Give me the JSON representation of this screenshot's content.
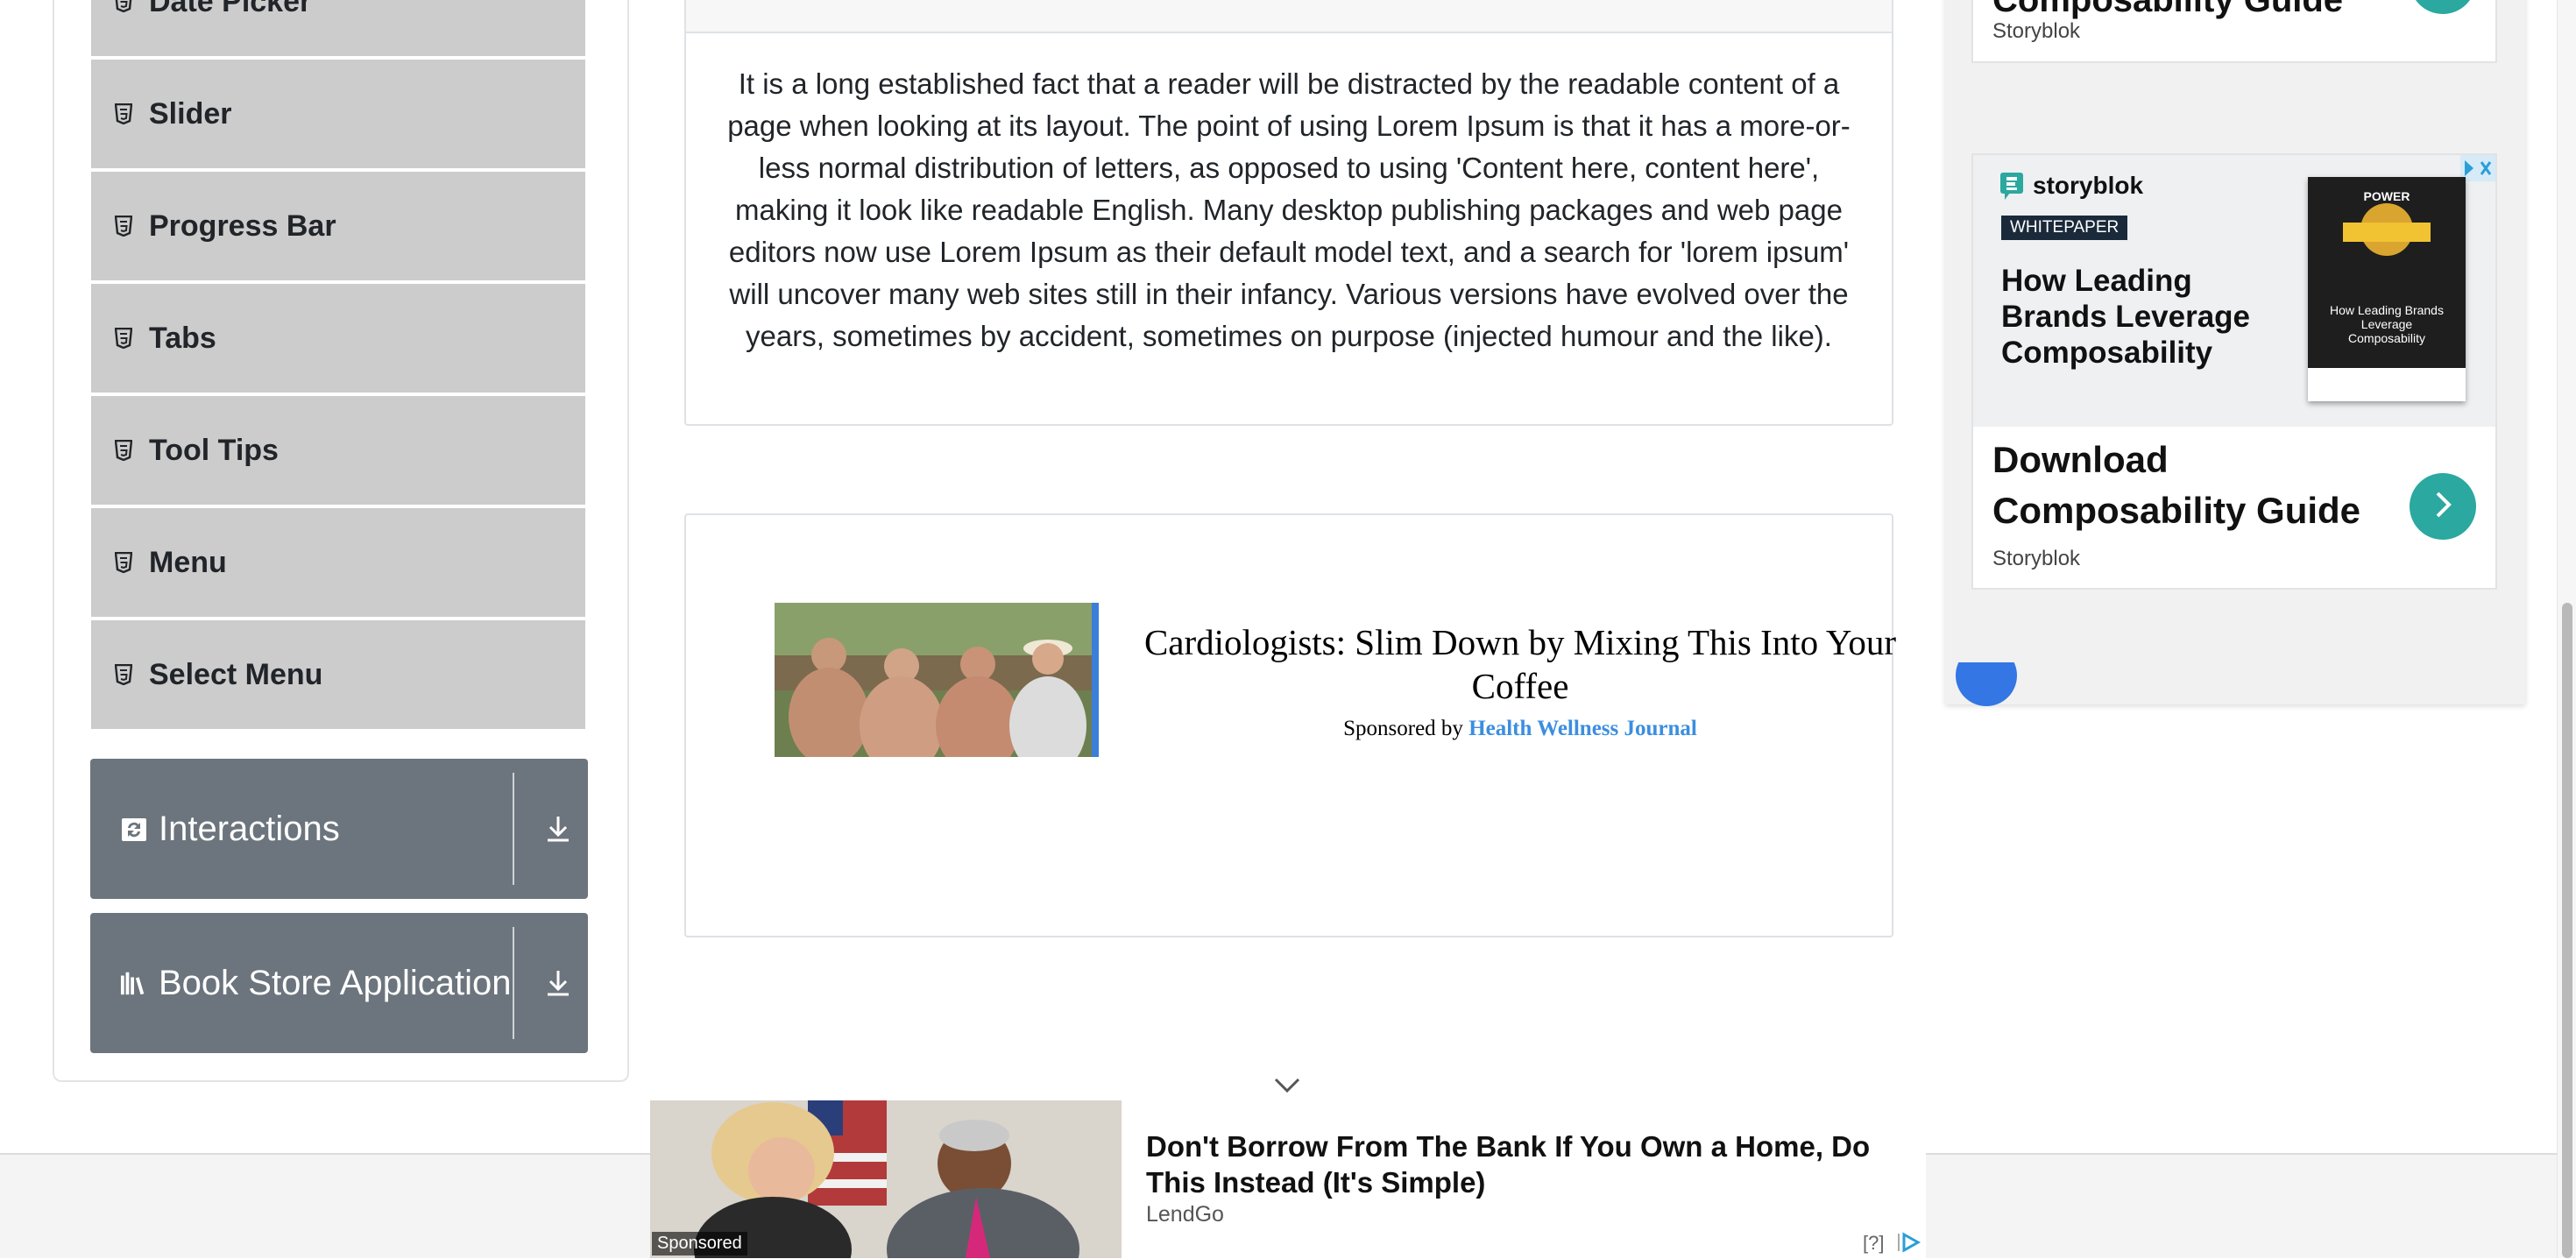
{
  "sidebar": {
    "elements_items": [
      {
        "label": "Date Picker"
      },
      {
        "label": "Slider"
      },
      {
        "label": "Progress Bar"
      },
      {
        "label": "Tabs"
      },
      {
        "label": "Tool Tips"
      },
      {
        "label": "Menu"
      },
      {
        "label": "Select Menu"
      }
    ],
    "groups": [
      {
        "label": "Interactions",
        "icon": "interactions-icon"
      },
      {
        "label": "Book Store Application",
        "icon": "book-store-icon"
      }
    ]
  },
  "article": {
    "text": "It is a long established fact that a reader will be distracted by the readable content of a page when looking at its layout. The point of using Lorem Ipsum is that it has a more-or-less normal distribution of letters, as opposed to using 'Content here, content here', making it look like readable English. Many desktop publishing packages and web page editors now use Lorem Ipsum as their default model text, and a search for 'lorem ipsum' will uncover many web sites still in their infancy. Various versions have evolved over the years, sometimes by accident, sometimes on purpose (injected humour and the like)."
  },
  "inline_ad": {
    "title": "Cardiologists: Slim Down by Mixing This Into Your Coffee",
    "sponsored_prefix": "Sponsored by",
    "sponsor": "Health Wellness Journal"
  },
  "right_ad": {
    "top_card_title": "Composability Guide",
    "top_card_brand": "Storyblok",
    "brand_logo_text": "storyblok",
    "badge": "WHITEPAPER",
    "headline": "How Leading Brands Leverage Composability",
    "book_title": "POWER",
    "book_sub": "How Leading Brands Leverage Composability",
    "cta": "Download Composability Guide",
    "brand": "Storyblok"
  },
  "bottom_ad": {
    "title": "Don't Borrow From The Bank If You Own a Home, Do This Instead (It's Simple)",
    "source": "LendGo",
    "sponsored_label": "Sponsored",
    "help": "[?]"
  },
  "colors": {
    "menu_bg": "#cccccc",
    "group_bg": "#6c757d",
    "cta_arrow": "#2ba89f",
    "sponsor_link": "#3b8ee0"
  }
}
